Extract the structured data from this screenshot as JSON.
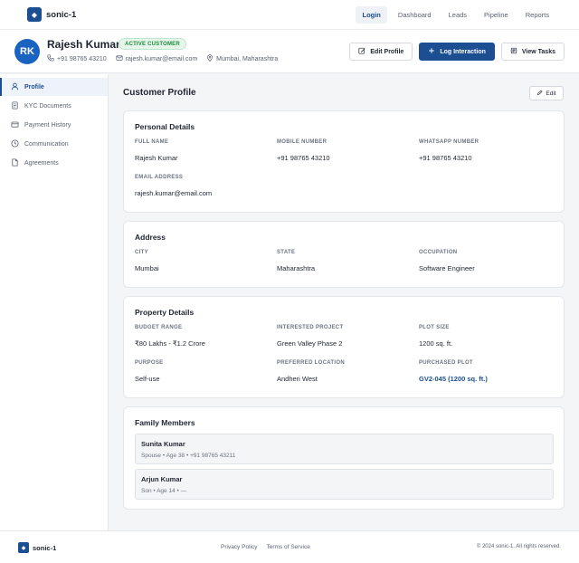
{
  "app": {
    "name": "sonic-1",
    "logo_glyph": "◆"
  },
  "nav": {
    "items": [
      "Login",
      "Dashboard",
      "Leads",
      "Pipeline",
      "Reports"
    ],
    "active": "Login"
  },
  "customer": {
    "initials": "RK",
    "name": "Rajesh Kumar",
    "status": "ACTIVE CUSTOMER",
    "phone": "+91 98765 43210",
    "email": "rajesh.kumar@email.com",
    "location": "Mumbai, Maharashtra"
  },
  "actions": {
    "edit_profile": "Edit Profile",
    "log_interaction": "Log Interaction",
    "view_tasks": "View Tasks"
  },
  "sidebar": {
    "items": [
      {
        "label": "Profile",
        "icon": "user-icon"
      },
      {
        "label": "KYC Documents",
        "icon": "document-icon"
      },
      {
        "label": "Payment History",
        "icon": "card-icon"
      },
      {
        "label": "Communication",
        "icon": "clock-icon"
      },
      {
        "label": "Agreements",
        "icon": "file-icon"
      }
    ],
    "active": "Profile"
  },
  "main": {
    "title": "Customer Profile",
    "edit_label": "Edit",
    "personal": {
      "title": "Personal Details",
      "full_name_label": "FULL NAME",
      "full_name": "Rajesh Kumar",
      "mobile_label": "MOBILE NUMBER",
      "mobile": "+91 98765 43210",
      "whatsapp_label": "WHATSAPP NUMBER",
      "whatsapp": "+91 98765 43210",
      "email_label": "EMAIL ADDRESS",
      "email": "rajesh.kumar@email.com"
    },
    "address": {
      "title": "Address",
      "city_label": "CITY",
      "city": "Mumbai",
      "state_label": "STATE",
      "state": "Maharashtra",
      "occupation_label": "OCCUPATION",
      "occupation": "Software Engineer"
    },
    "property": {
      "title": "Property Details",
      "budget_label": "BUDGET RANGE",
      "budget": "₹80 Lakhs - ₹1.2 Crore",
      "project_label": "INTERESTED PROJECT",
      "project": "Green Valley Phase 2",
      "plot_size_label": "PLOT SIZE",
      "plot_size": "1200 sq. ft.",
      "purpose_label": "PURPOSE",
      "purpose": "Self-use",
      "location_label": "PREFERRED LOCATION",
      "location": "Andheri West",
      "purchased_label": "PURCHASED PLOT",
      "purchased": "GV2-045 (1200 sq. ft.)"
    },
    "family": {
      "title": "Family Members",
      "members": [
        {
          "name": "Sunita Kumar",
          "info": "Spouse • Age 38 • +91 98765 43211"
        },
        {
          "name": "Arjun Kumar",
          "info": "Son • Age 14 • —"
        }
      ]
    }
  },
  "footer": {
    "brand": "sonic-1",
    "links": [
      "Privacy Policy",
      "Terms of Service"
    ],
    "copyright": "© 2024 sonic-1. All rights reserved."
  },
  "colors": {
    "primary": "#1b4f91",
    "avatar": "#1b63c0",
    "badge_green": "#1d8a3e"
  }
}
